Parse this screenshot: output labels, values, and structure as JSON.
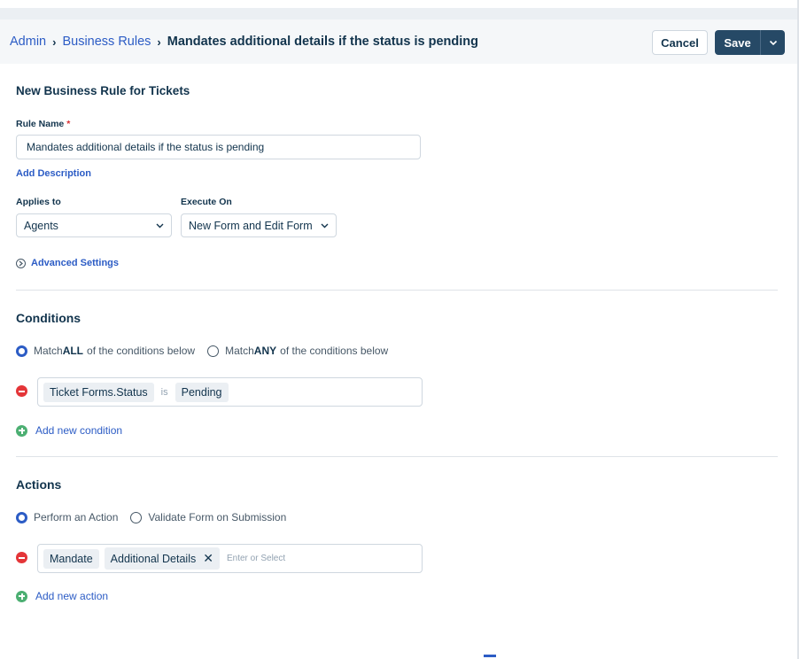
{
  "breadcrumb": {
    "admin": "Admin",
    "business_rules": "Business Rules",
    "current": "Mandates additional details if the status is pending"
  },
  "header": {
    "cancel_label": "Cancel",
    "save_label": "Save"
  },
  "form": {
    "title": "New Business Rule for Tickets",
    "rule_name_label": "Rule Name",
    "required_mark": "*",
    "rule_name_value": "Mandates additional details if the status is pending",
    "add_description": "Add Description",
    "applies_to_label": "Applies to",
    "applies_to_value": "Agents",
    "execute_on_label": "Execute On",
    "execute_on_value": "New Form and Edit Form",
    "advanced_settings": "Advanced Settings"
  },
  "conditions": {
    "title": "Conditions",
    "match_all_pre": "Match ",
    "match_all_bold": "ALL",
    "match_all_post": " of the conditions below",
    "match_any_pre": "Match ",
    "match_any_bold": "ANY",
    "match_any_post": " of the conditions below",
    "selected": "all",
    "row": {
      "field": "Ticket Forms.Status",
      "operator": "is",
      "value": "Pending"
    },
    "add_label": "Add new condition"
  },
  "actions": {
    "title": "Actions",
    "option_perform": "Perform an Action",
    "option_validate": "Validate Form on Submission",
    "selected": "perform",
    "row": {
      "action": "Mandate",
      "target": "Additional Details",
      "placeholder": "Enter or Select"
    },
    "add_label": "Add new action"
  },
  "colors": {
    "primary": "#264966",
    "link": "#2c5cc5",
    "danger": "#e43538",
    "success": "#4caf72"
  }
}
